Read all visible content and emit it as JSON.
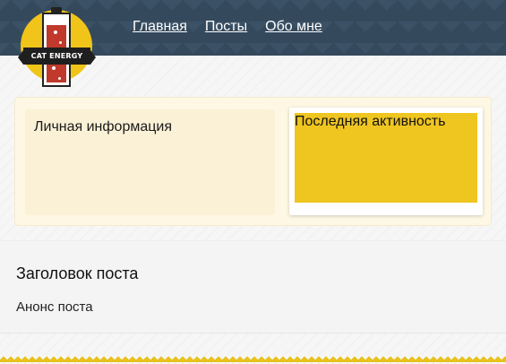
{
  "logo": {
    "text": "CAT ENERGY"
  },
  "nav": {
    "items": [
      {
        "label": "Главная"
      },
      {
        "label": "Посты"
      },
      {
        "label": "Обо мне"
      }
    ]
  },
  "profile": {
    "personal_info_title": "Личная информация",
    "recent_activity_title": "Последняя активность"
  },
  "post": {
    "title": "Заголовок поста",
    "excerpt": "Анонс поста"
  },
  "colors": {
    "header_bg": "#34495c",
    "accent_yellow": "#efc520",
    "battery_red": "#c0392b"
  },
  "icons": [
    "cat-energy-logo"
  ]
}
